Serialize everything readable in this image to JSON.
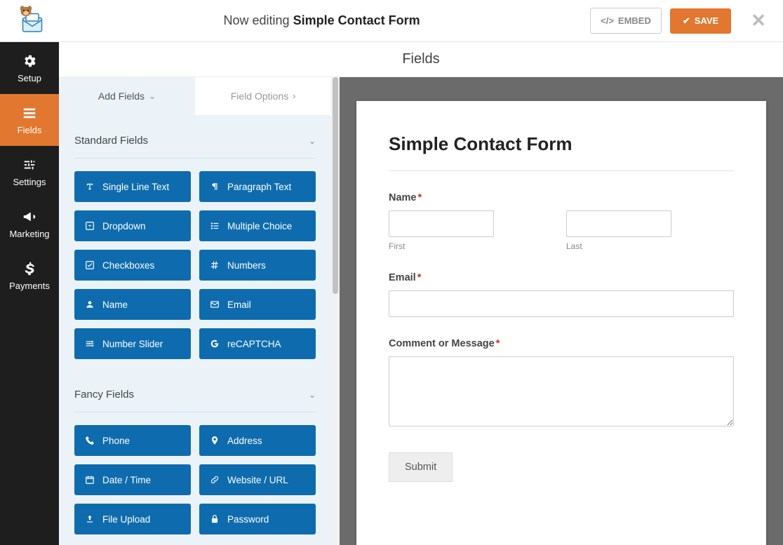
{
  "header": {
    "editing_prefix": "Now editing",
    "form_name": "Simple Contact Form",
    "embed_label": "EMBED",
    "save_label": "SAVE"
  },
  "nav": {
    "items": [
      {
        "id": "setup",
        "label": "Setup",
        "icon": "gear"
      },
      {
        "id": "fields",
        "label": "Fields",
        "icon": "list"
      },
      {
        "id": "settings",
        "label": "Settings",
        "icon": "sliders"
      },
      {
        "id": "marketing",
        "label": "Marketing",
        "icon": "bullhorn"
      },
      {
        "id": "payments",
        "label": "Payments",
        "icon": "dollar"
      }
    ],
    "active": "fields"
  },
  "page_title": "Fields",
  "tabs": {
    "add": "Add Fields",
    "options": "Field Options"
  },
  "sections": {
    "standard": {
      "title": "Standard Fields",
      "items": [
        {
          "id": "single-line",
          "label": "Single Line Text",
          "icon": "text"
        },
        {
          "id": "paragraph",
          "label": "Paragraph Text",
          "icon": "paragraph"
        },
        {
          "id": "dropdown",
          "label": "Dropdown",
          "icon": "caret-sq"
        },
        {
          "id": "multiple-choice",
          "label": "Multiple Choice",
          "icon": "list-ul"
        },
        {
          "id": "checkboxes",
          "label": "Checkboxes",
          "icon": "check-sq"
        },
        {
          "id": "numbers",
          "label": "Numbers",
          "icon": "hash"
        },
        {
          "id": "name",
          "label": "Name",
          "icon": "user"
        },
        {
          "id": "email",
          "label": "Email",
          "icon": "envelope"
        },
        {
          "id": "number-slider",
          "label": "Number Slider",
          "icon": "sliders-h"
        },
        {
          "id": "recaptcha",
          "label": "reCAPTCHA",
          "icon": "google"
        }
      ]
    },
    "fancy": {
      "title": "Fancy Fields",
      "items": [
        {
          "id": "phone",
          "label": "Phone",
          "icon": "phone"
        },
        {
          "id": "address",
          "label": "Address",
          "icon": "pin"
        },
        {
          "id": "datetime",
          "label": "Date / Time",
          "icon": "calendar"
        },
        {
          "id": "website",
          "label": "Website / URL",
          "icon": "link"
        },
        {
          "id": "upload",
          "label": "File Upload",
          "icon": "upload"
        },
        {
          "id": "password",
          "label": "Password",
          "icon": "lock"
        }
      ]
    }
  },
  "form": {
    "title": "Simple Contact Form",
    "fields": {
      "name": {
        "label": "Name",
        "first": "First",
        "last": "Last"
      },
      "email": {
        "label": "Email"
      },
      "comment": {
        "label": "Comment or Message"
      }
    },
    "submit": "Submit"
  }
}
